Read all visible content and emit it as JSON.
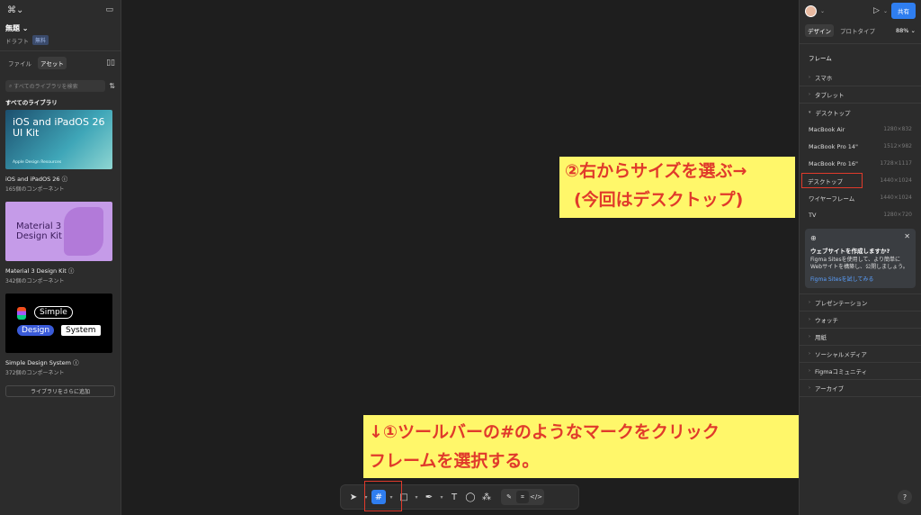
{
  "left": {
    "logo": "≡",
    "doc_title": "無題",
    "doc_sub": "ドラフト",
    "doc_badge": "無料",
    "tabs": [
      "ファイル",
      "アセット"
    ],
    "search_placeholder": "すべてのライブラリを検索",
    "section_title": "すべてのライブラリ",
    "libraries": [
      {
        "thumb_title": "iOS and iPadOS 26\nUI Kit",
        "thumb_sub": "Apple Design Resources",
        "name": "iOS and iPadOS 26",
        "count": "165個のコンポーネント"
      },
      {
        "thumb_title": "Material 3\nDesign Kit",
        "name": "Material 3 Design Kit",
        "count": "342個のコンポーネント"
      },
      {
        "thumb_words": [
          "Simple",
          "Design",
          "System"
        ],
        "name": "Simple Design System",
        "count": "372個のコンポーネント"
      }
    ],
    "add_button": "ライブラリをさらに追加"
  },
  "right": {
    "share": "共有",
    "tabs": [
      "デザイン",
      "プロトタイプ"
    ],
    "zoom": "88%",
    "frame_header": "フレーム",
    "groups_top": [
      "スマホ",
      "タブレット",
      "デスクトップ"
    ],
    "desktop_items": [
      {
        "name": "MacBook Air",
        "size": "1280×832"
      },
      {
        "name": "MacBook Pro 14\"",
        "size": "1512×982"
      },
      {
        "name": "MacBook Pro 16\"",
        "size": "1728×1117"
      },
      {
        "name": "デスクトップ",
        "size": "1440×1024"
      },
      {
        "name": "ワイヤーフレーム",
        "size": "1440×1024"
      },
      {
        "name": "TV",
        "size": "1280×720"
      }
    ],
    "card": {
      "title": "ウェブサイトを作成しますか?",
      "body": "Figma Sitesを使用して、より簡単にWebサイトを構築し、公開しましょう。",
      "link": "Figma Sitesを試してみる"
    },
    "groups_bottom": [
      "プレゼンテーション",
      "ウォッチ",
      "用紙",
      "ソーシャルメディア",
      "Figmaコミュニティ",
      "アーカイブ"
    ],
    "help": "?"
  },
  "annotations": {
    "right_l1": "②右からサイズを選ぶ→",
    "right_l2": "(今回はデスクトップ)",
    "bottom_l1": "↓①ツールバーの#のようなマークをクリック",
    "bottom_l2": "フレームを選択する。"
  },
  "toolbar_icons": [
    "move-icon",
    "frame-icon",
    "rectangle-icon",
    "pen-icon",
    "text-icon",
    "comment-icon",
    "actions-icon"
  ]
}
